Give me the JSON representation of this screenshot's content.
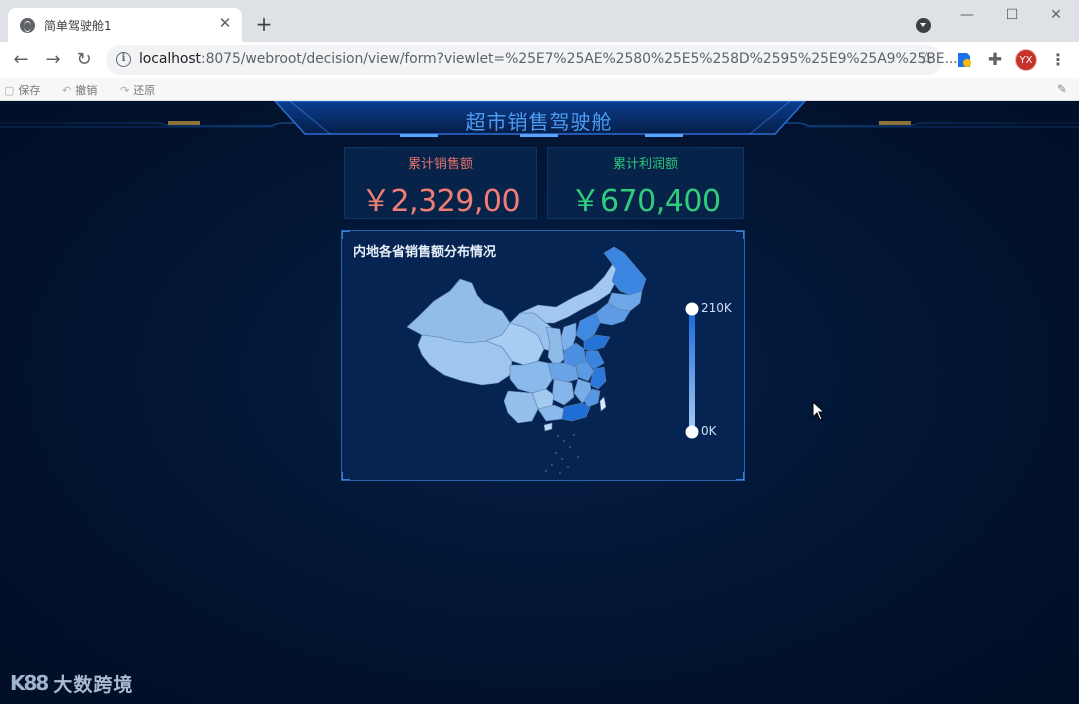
{
  "browser": {
    "tab_title": "简单驾驶舱1",
    "url_host": "localhost",
    "url_rest": ":8075/webroot/decision/view/form?viewlet=%25E7%25AE%2580%25E5%258D%2595%25E9%25A9%25BE...",
    "avatar_initials": "YX",
    "icons": [
      "globe-icon",
      "close-icon",
      "plus-icon",
      "tab-search-icon",
      "minimize-icon",
      "maximize-icon",
      "window-close-icon",
      "back-icon",
      "forward-icon",
      "reload-icon",
      "info-icon",
      "star-icon",
      "extension-icon",
      "puzzle-icon",
      "menu-icon"
    ]
  },
  "app_toolbar": {
    "save_label": "保存",
    "undo_label": "撤销",
    "redo_label": "还原"
  },
  "dashboard": {
    "title": "超市销售驾驶舱",
    "kpis": [
      {
        "label": "累计销售额",
        "value": "￥2,329,00",
        "color": "#ef7e74"
      },
      {
        "label": "累计利润额",
        "value": "￥670,400",
        "color": "#2fcc7c"
      }
    ],
    "map_panel": {
      "title": "内地各省销售额分布情况",
      "visual_map_max": "210K",
      "visual_map_min": "0K",
      "color_range": [
        "#a9cdf2",
        "#1565d8"
      ]
    }
  },
  "watermark": {
    "logo": "K88",
    "text": "大数跨境"
  }
}
